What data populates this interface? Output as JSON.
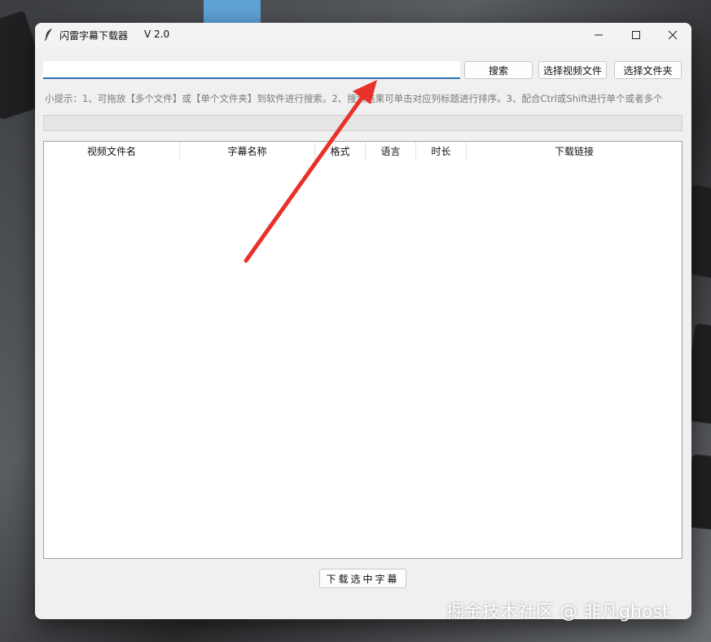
{
  "window": {
    "title": "闪雷字幕下载器",
    "version": "V 2.0"
  },
  "search": {
    "value": "",
    "placeholder": ""
  },
  "toolbar": {
    "search_label": "搜索",
    "select_video_label": "选择视频文件",
    "select_folder_label": "选择文件夹"
  },
  "hint": "小提示：1、可拖放【多个文件】或【单个文件夹】到软件进行搜索。2、搜索结果可单击对应列标题进行排序。3、配合Ctrl或Shift进行单个或者多个",
  "progress": {
    "value": 0
  },
  "table": {
    "columns": [
      "视频文件名",
      "字幕名称",
      "格式",
      "语言",
      "时长",
      "下载链接"
    ],
    "rows": []
  },
  "footer": {
    "download_label": "下载选中字幕"
  },
  "watermark": "掘金技术社区 @ 非凡ghost",
  "colors": {
    "accent": "#2f6fb3",
    "arrow": "#e8312a"
  },
  "icons": {
    "app": "feather-icon",
    "minimize": "minimize-icon",
    "maximize": "maximize-icon",
    "close": "close-icon"
  }
}
